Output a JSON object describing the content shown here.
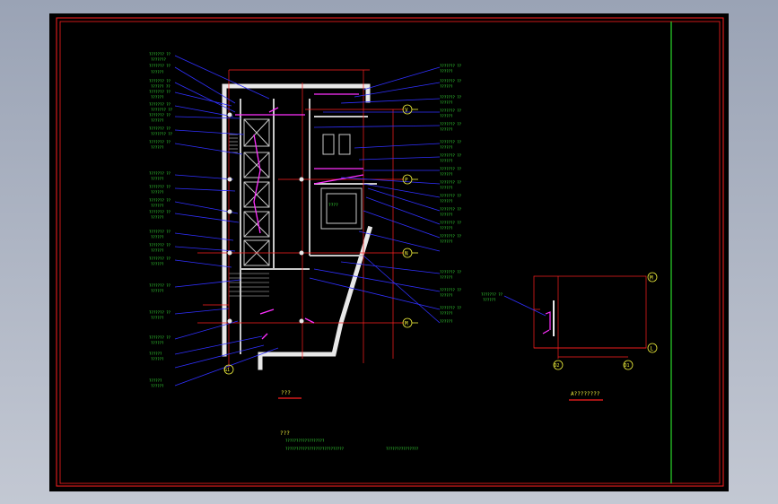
{
  "sheet": {
    "colors": {
      "background": "#000000",
      "frame": "#ff2020",
      "green": "#2cd92c",
      "wall": "#e8e8e8",
      "blue": "#3030ff",
      "magenta": "#ff30ff",
      "yellow": "#f0f03c",
      "label": "#3cf03c"
    }
  },
  "grid_bubbles": {
    "main": [
      "V",
      "P",
      "N",
      "M",
      "G1"
    ],
    "detail": [
      "M",
      "L",
      "D2",
      "D1"
    ]
  },
  "titles": {
    "main_plan": "???",
    "detail_plan": "A????????"
  },
  "notes": {
    "heading": "???",
    "line1": "??????????????????",
    "line2": "???????????????????????????",
    "line3": "???????????????"
  },
  "room_label": "????"
}
